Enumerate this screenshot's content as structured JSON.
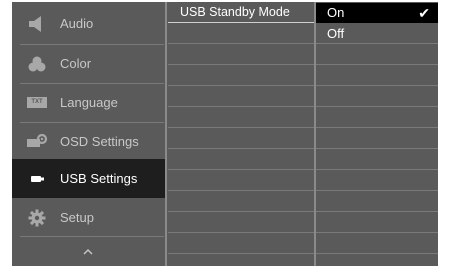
{
  "menu": {
    "items": [
      {
        "label": "Audio",
        "icon": "speaker-icon"
      },
      {
        "label": "Color",
        "icon": "color-icon"
      },
      {
        "label": "Language",
        "icon": "language-icon",
        "icon_text": "TXT"
      },
      {
        "label": "OSD Settings",
        "icon": "osd-settings-icon"
      },
      {
        "label": "USB Settings",
        "icon": "usb-icon",
        "active": true
      },
      {
        "label": "Setup",
        "icon": "gear-icon"
      }
    ],
    "scroll_icon": "chevron-up-icon"
  },
  "submenu": {
    "items": [
      {
        "label": "USB Standby Mode"
      }
    ]
  },
  "options": {
    "items": [
      {
        "label": "On",
        "selected": true,
        "check": "✔"
      },
      {
        "label": "Off",
        "selected": false
      }
    ]
  },
  "colors": {
    "panel": "#5a5a5a",
    "active_bg": "#1e1e1e",
    "selected_option_bg": "#000000",
    "text": "#c8c8c8",
    "active_text": "#ffffff"
  }
}
